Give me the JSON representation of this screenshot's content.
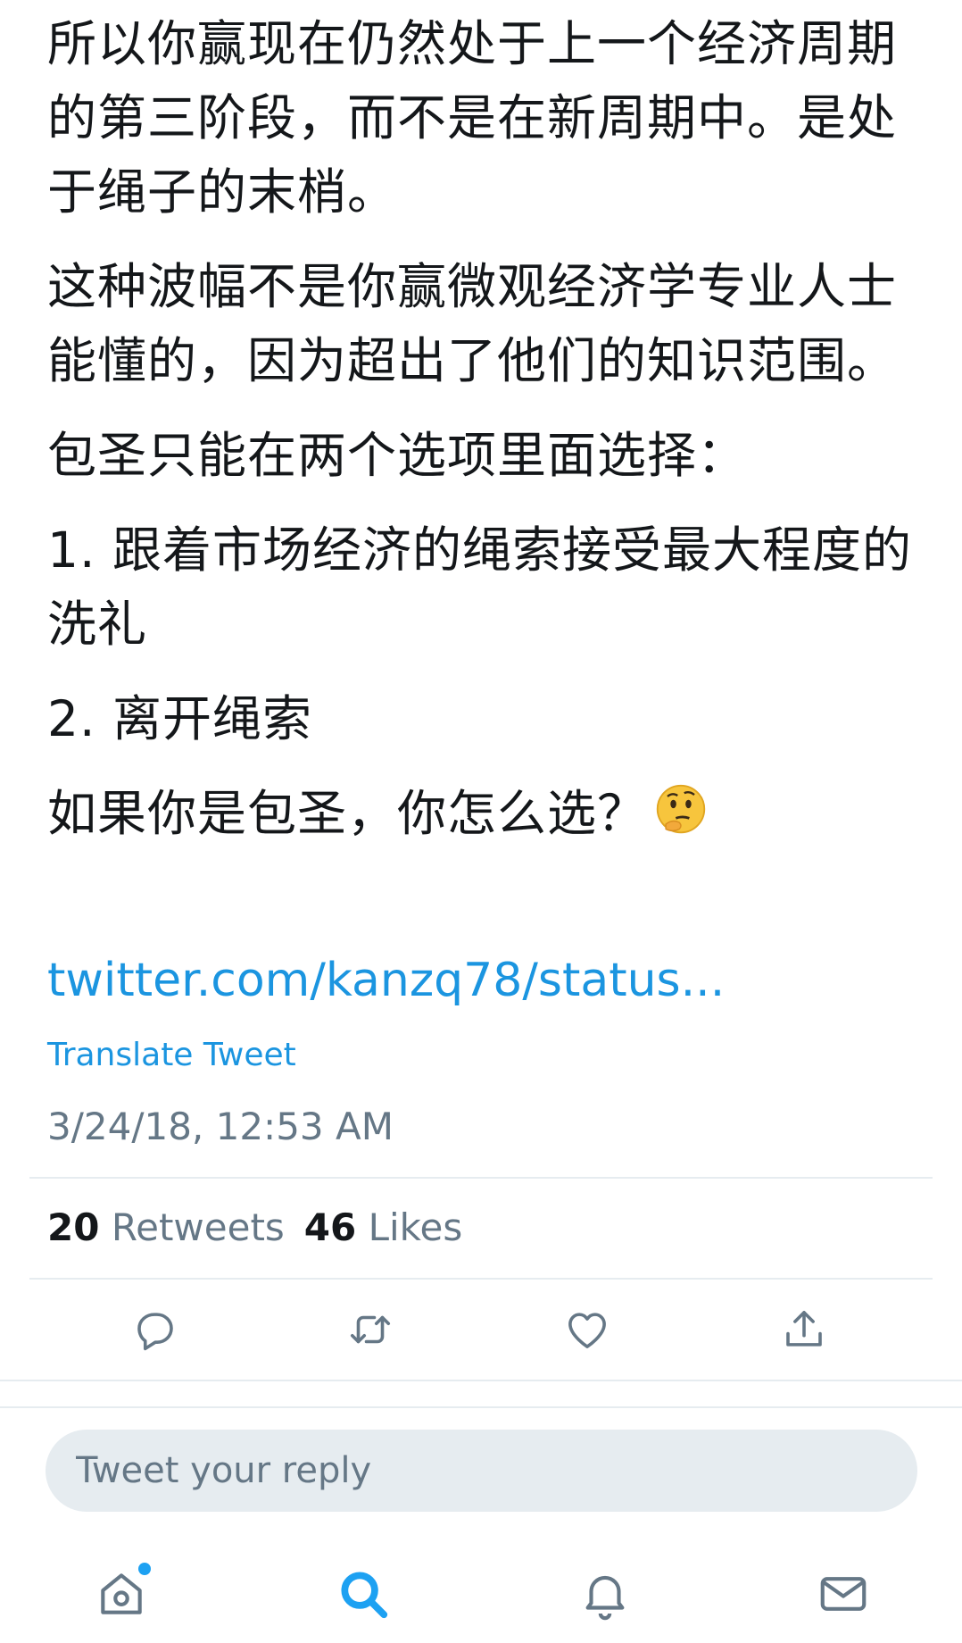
{
  "tweet": {
    "paragraphs": [
      "所以你赢现在仍然处于上一个经济周期的第三阶段，而不是在新周期中。是处于绳子的末梢。",
      "这种波幅不是你赢微观经济学专业人士能懂的，因为超出了他们的知识范围。",
      "包圣只能在两个选项里面选择：",
      "1. 跟着市场经济的绳索接受最大程度的洗礼",
      "2. 离开绳索",
      "如果你是包圣，你怎么选？"
    ],
    "emoji": "thinking-face",
    "link": "twitter.com/kanzq78/status...",
    "translate_label": "Translate Tweet",
    "timestamp": "3/24/18, 12:53 AM"
  },
  "stats": {
    "retweets_count": "20",
    "retweets_label": "Retweets",
    "likes_count": "46",
    "likes_label": "Likes"
  },
  "actions": [
    "reply-icon",
    "retweet-icon",
    "like-icon",
    "share-icon"
  ],
  "reply": {
    "placeholder": "Tweet your reply"
  },
  "nav": {
    "items": [
      "home-icon",
      "search-icon",
      "notifications-icon",
      "messages-icon"
    ],
    "active": "search-icon",
    "home_has_notification_dot": true
  },
  "colors": {
    "link": "#1b95e0",
    "secondary_text": "#657786",
    "divider": "#e6ecf0",
    "accent": "#1da1f2"
  }
}
